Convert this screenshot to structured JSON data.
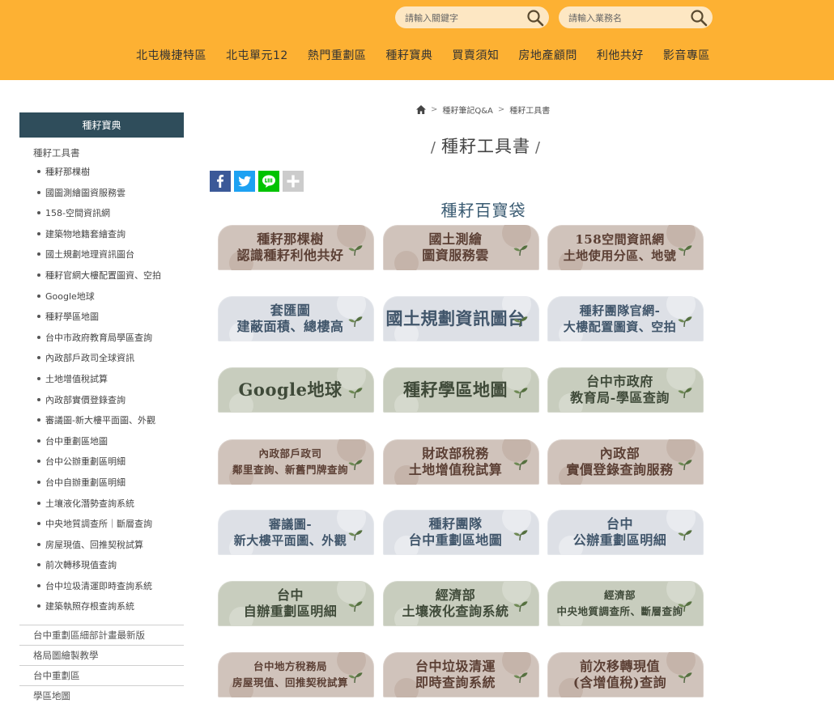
{
  "header": {
    "search_keyword_placeholder": "請輸入關鍵字",
    "search_agent_placeholder": "請輸入業務名",
    "nav": [
      "北屯機捷特區",
      "北屯單元12",
      "熱門重劃區",
      "種耔寶典",
      "買賣須知",
      "房地產顧問",
      "利他共好",
      "影音專區"
    ]
  },
  "sidebar": {
    "heading": "種耔寶典",
    "group_title": "種耔工具書",
    "sub_items": [
      "種耔那棵樹",
      "國圖測繪圖資服務雲",
      "158-空間資訊網",
      "建築物地籍套繪查詢",
      "國土規劃地理資訊圖台",
      "種耔官網大樓配置圖資、空拍",
      "Google地球",
      "種耔學區地圖",
      "台中市政府教育局學區查詢",
      "內政部戶政司全球資訊",
      "土地增值稅試算",
      "內政部實價登錄查詢",
      "審議圖-新大樓平面圖、外觀",
      "台中重劃區地圖",
      "台中公辦重劃區明細",
      "台中自辦重劃區明細",
      "土壤液化潛勢查詢系統",
      "中央地質調查所｜斷層查詢",
      "房屋現值、回推契稅試算",
      "前次轉移現值查詢",
      "台中垃圾清運即時查詢系統",
      "建築執照存根查詢系統"
    ],
    "main_items": [
      "台中重劃區細部計畫最新版",
      "格局圖繪製教學",
      "台中重劃區",
      "學區地圖"
    ]
  },
  "breadcrumb": {
    "level1": "種耔筆記Q&A",
    "level2": "種耔工具書"
  },
  "page_title": "種耔工具書",
  "section_title": "種耔百寶袋",
  "tiles": [
    {
      "lines": [
        "種耔那棵樹",
        "認識種耔利他共好"
      ],
      "theme": "brown"
    },
    {
      "lines": [
        "國土測繪",
        "圖資服務雲"
      ],
      "theme": "brown"
    },
    {
      "lines": [
        "158空間資訊網",
        "土地使用分區、地號"
      ],
      "theme": "brown"
    },
    {
      "lines": [
        "套匯圖",
        "建蔽面積、總樓高"
      ],
      "theme": "grey"
    },
    {
      "lines": [
        "國土規劃資訊圖台"
      ],
      "theme": "grey"
    },
    {
      "lines": [
        "種耔團隊官網-",
        "大樓配置圖資、空拍"
      ],
      "theme": "grey"
    },
    {
      "lines": [
        "Google地球"
      ],
      "theme": "green"
    },
    {
      "lines": [
        "種耔學區地圖"
      ],
      "theme": "green"
    },
    {
      "lines": [
        "台中市政府",
        "教育局-學區查詢"
      ],
      "theme": "green"
    },
    {
      "lines": [
        "內政部戶政司",
        "鄰里查詢、新舊門牌查詢"
      ],
      "theme": "brown"
    },
    {
      "lines": [
        "財政部稅務",
        "土地增值稅試算"
      ],
      "theme": "brown"
    },
    {
      "lines": [
        "內政部",
        "實價登錄查詢服務"
      ],
      "theme": "brown"
    },
    {
      "lines": [
        "審議圖-",
        "新大樓平面圖、外觀"
      ],
      "theme": "grey"
    },
    {
      "lines": [
        "種耔團隊",
        "台中重劃區地圖"
      ],
      "theme": "grey"
    },
    {
      "lines": [
        "台中",
        "公辦重劃區明細"
      ],
      "theme": "grey"
    },
    {
      "lines": [
        "台中",
        "自辦重劃區明細"
      ],
      "theme": "green"
    },
    {
      "lines": [
        "經濟部",
        "土壤液化查詢系統"
      ],
      "theme": "green"
    },
    {
      "lines": [
        "經濟部",
        "中央地質調查所、斷層查詢"
      ],
      "theme": "green"
    },
    {
      "lines": [
        "台中地方稅務局",
        "房屋現值、回推契稅試算"
      ],
      "theme": "brown"
    },
    {
      "lines": [
        "台中垃圾清運",
        "即時查詢系統"
      ],
      "theme": "brown"
    },
    {
      "lines": [
        "前次移轉現值",
        "(含增值稅)查詢"
      ],
      "theme": "brown"
    }
  ],
  "colors": {
    "header_bg": "#fdb133",
    "sidebar_head_bg": "#2f4d5b",
    "section_title": "#3a5b72",
    "facebook": "#3b5998",
    "twitter": "#1da1f2",
    "line": "#00c300",
    "share_more": "#cccccc"
  },
  "icons": {
    "search": "search-icon",
    "home": "home-icon",
    "facebook": "facebook-icon",
    "twitter": "twitter-icon",
    "line": "line-icon",
    "share_more": "plus-icon",
    "tile_decoration": "sprout-icon"
  }
}
